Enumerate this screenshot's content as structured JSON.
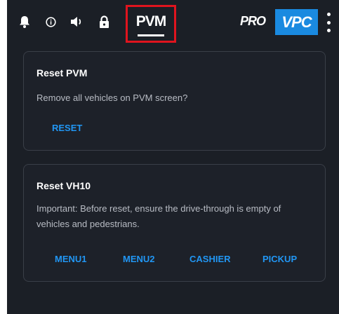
{
  "toolbar": {
    "icons": [
      "bell-icon",
      "info-icon",
      "speaker-icon",
      "lock-icon"
    ],
    "pvm_label": "PVM",
    "pro_label": "PRO",
    "vpc_label": "VPC",
    "accent": "#1a8ae0",
    "highlight": "#e0141e"
  },
  "reset_pvm": {
    "title": "Reset PVM",
    "description": "Remove all vehicles on PVM screen?",
    "action": "RESET"
  },
  "reset_vh10": {
    "title": "Reset VH10",
    "description": "Important: Before reset, ensure the drive-through is empty of vehicles and pedestrians.",
    "actions": [
      "MENU1",
      "MENU2",
      "CASHIER",
      "PICKUP"
    ]
  },
  "colors": {
    "background": "#1b1f26",
    "card_border": "#3a3f48",
    "action_text": "#2196f3"
  }
}
